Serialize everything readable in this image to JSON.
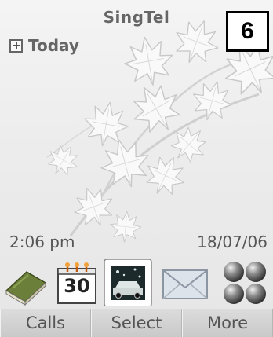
{
  "status": {
    "operator": "SingTel",
    "today_label": "Today"
  },
  "badge": {
    "number": "6"
  },
  "clock": {
    "time": "2:06 pm",
    "date": "18/07/06"
  },
  "dock": {
    "items": [
      {
        "icon": "phonebook-icon"
      },
      {
        "icon": "calendar-icon",
        "day": "30"
      },
      {
        "icon": "media-icon"
      },
      {
        "icon": "messages-icon"
      },
      {
        "icon": "apps-menu-icon"
      }
    ]
  },
  "softkeys": {
    "left": "Calls",
    "center": "Select",
    "right": "More"
  }
}
